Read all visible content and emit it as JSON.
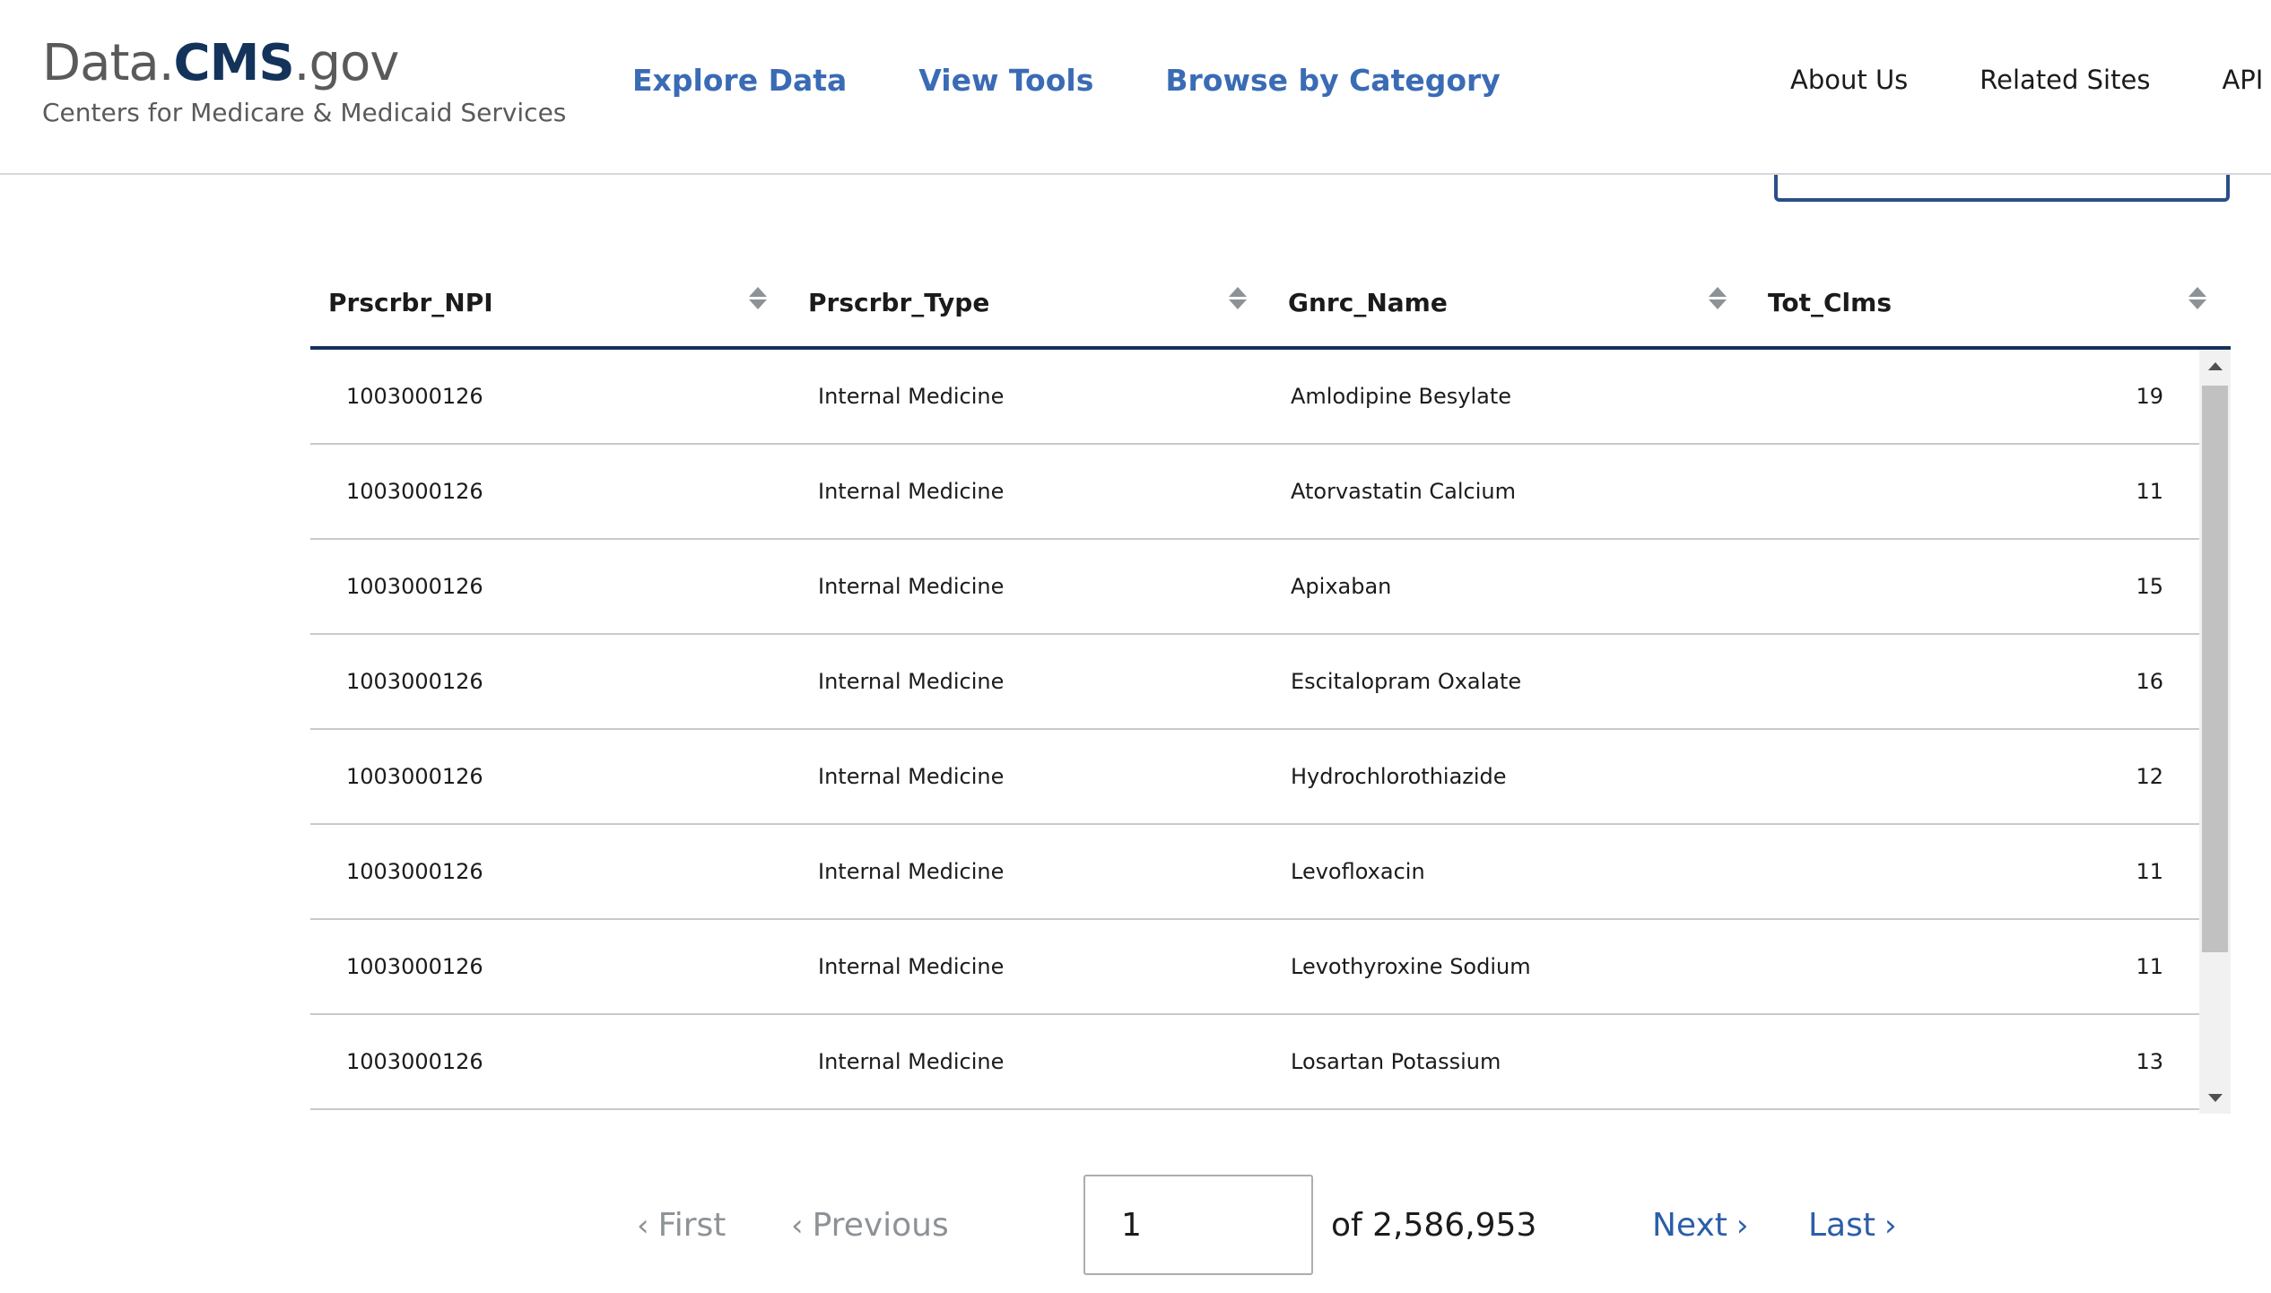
{
  "header": {
    "logo_prefix": "Data.",
    "logo_brand": "CMS",
    "logo_suffix": ".gov",
    "logo_subtitle": "Centers for Medicare & Medicaid Services",
    "primary_nav": [
      "Explore Data",
      "View Tools",
      "Browse by Category"
    ],
    "secondary_nav": [
      "About Us",
      "Related Sites",
      "API Do"
    ]
  },
  "table": {
    "columns": [
      "Prscrbr_NPI",
      "Prscrbr_Type",
      "Gnrc_Name",
      "Tot_Clms"
    ],
    "rows": [
      [
        "1003000126",
        "Internal Medicine",
        "Amlodipine Besylate",
        "19"
      ],
      [
        "1003000126",
        "Internal Medicine",
        "Atorvastatin Calcium",
        "11"
      ],
      [
        "1003000126",
        "Internal Medicine",
        "Apixaban",
        "15"
      ],
      [
        "1003000126",
        "Internal Medicine",
        "Escitalopram Oxalate",
        "16"
      ],
      [
        "1003000126",
        "Internal Medicine",
        "Hydrochlorothiazide",
        "12"
      ],
      [
        "1003000126",
        "Internal Medicine",
        "Levofloxacin",
        "11"
      ],
      [
        "1003000126",
        "Internal Medicine",
        "Levothyroxine Sodium",
        "11"
      ],
      [
        "1003000126",
        "Internal Medicine",
        "Losartan Potassium",
        "13"
      ]
    ]
  },
  "pagination": {
    "first_label": "First",
    "previous_label": "Previous",
    "current_page": "1",
    "of_total": "of 2,586,953",
    "next_label": "Next",
    "last_label": "Last"
  },
  "colors": {
    "brand_navy": "#13335b",
    "link_blue": "#3a6bb5",
    "disabled_gray": "#8d9297"
  },
  "icons": {
    "sort": "sort-icon",
    "chevron_left": "chevron-left-icon",
    "chevron_right": "chevron-right-icon"
  }
}
